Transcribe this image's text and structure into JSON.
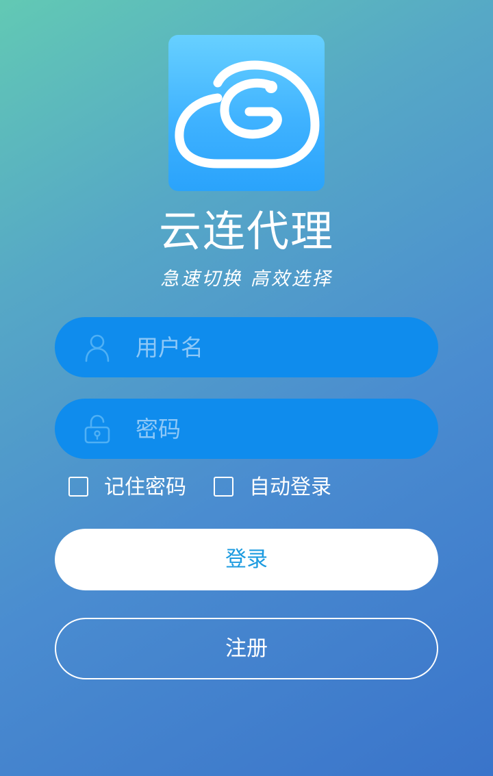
{
  "app": {
    "title": "云连代理",
    "slogan": "急速切换 高效选择",
    "logo_icon": "cloud-g-logo-icon"
  },
  "colors": {
    "accent": "#0f8ced",
    "login_text": "#1c9be0",
    "placeholder": "#8ec8f7"
  },
  "form": {
    "username": {
      "placeholder": "用户名",
      "value": "",
      "icon": "user-icon"
    },
    "password": {
      "placeholder": "密码",
      "value": "",
      "icon": "lock-icon"
    },
    "remember_password": {
      "label": "记住密码",
      "checked": false
    },
    "auto_login": {
      "label": "自动登录",
      "checked": false
    },
    "login_label": "登录",
    "register_label": "注册"
  }
}
